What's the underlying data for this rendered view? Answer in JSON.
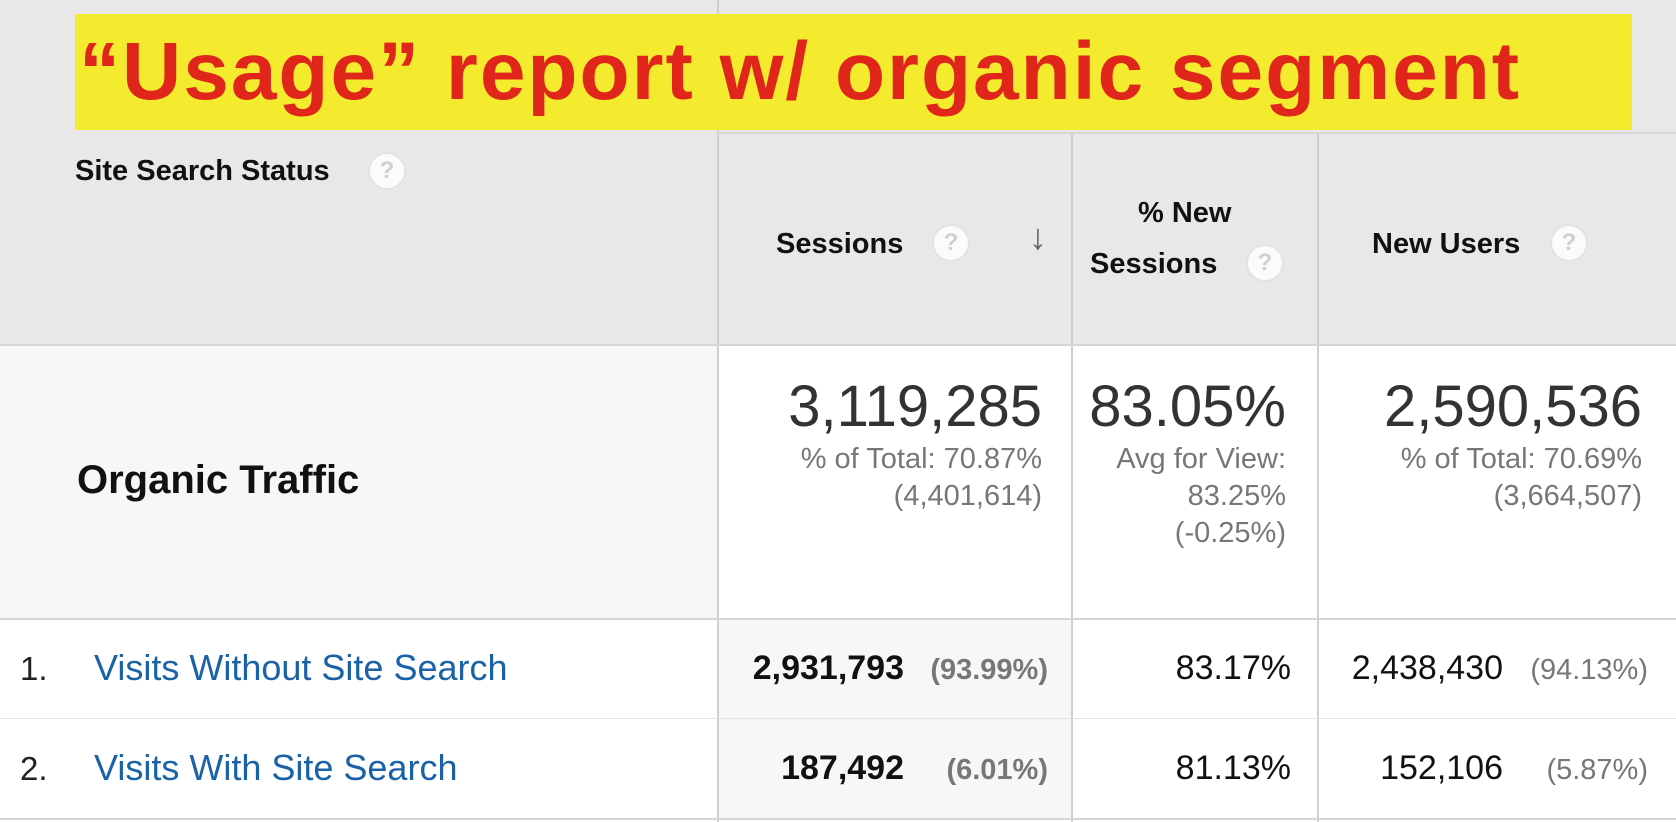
{
  "annotation": {
    "text": "“Usage” report w/ organic segment"
  },
  "header": {
    "dimension_label": "Site Search Status",
    "columns": [
      {
        "label": "Sessions",
        "sorted": "descending"
      },
      {
        "label_line1": "% New",
        "label_line2": "Sessions"
      },
      {
        "label": "New Users"
      }
    ],
    "help_glyph": "?",
    "sort_glyph": "↓"
  },
  "segment": {
    "name": "Organic Traffic",
    "sessions": {
      "value": "3,119,285",
      "line1": "% of Total: 70.87%",
      "line2": "(4,401,614)"
    },
    "pct_new_sessions": {
      "value": "83.05%",
      "line1": "Avg for View:",
      "line2": "83.25%",
      "line3": "(-0.25%)"
    },
    "new_users": {
      "value": "2,590,536",
      "line1": "% of Total: 70.69%",
      "line2": "(3,664,507)"
    }
  },
  "rows": [
    {
      "index": "1.",
      "label": "Visits Without Site Search",
      "sessions": "2,931,793",
      "sessions_pct": "(93.99%)",
      "pct_new_sessions": "83.17%",
      "new_users": "2,438,430",
      "new_users_pct": "(94.13%)"
    },
    {
      "index": "2.",
      "label": "Visits With Site Search",
      "sessions": "187,492",
      "sessions_pct": "(6.01%)",
      "pct_new_sessions": "81.13%",
      "new_users": "152,106",
      "new_users_pct": "(5.87%)"
    }
  ],
  "colors": {
    "banner_bg": "#f4ea2e",
    "banner_text": "#e0251b",
    "header_bg": "#e8e8e8",
    "link": "#1a62a8"
  }
}
